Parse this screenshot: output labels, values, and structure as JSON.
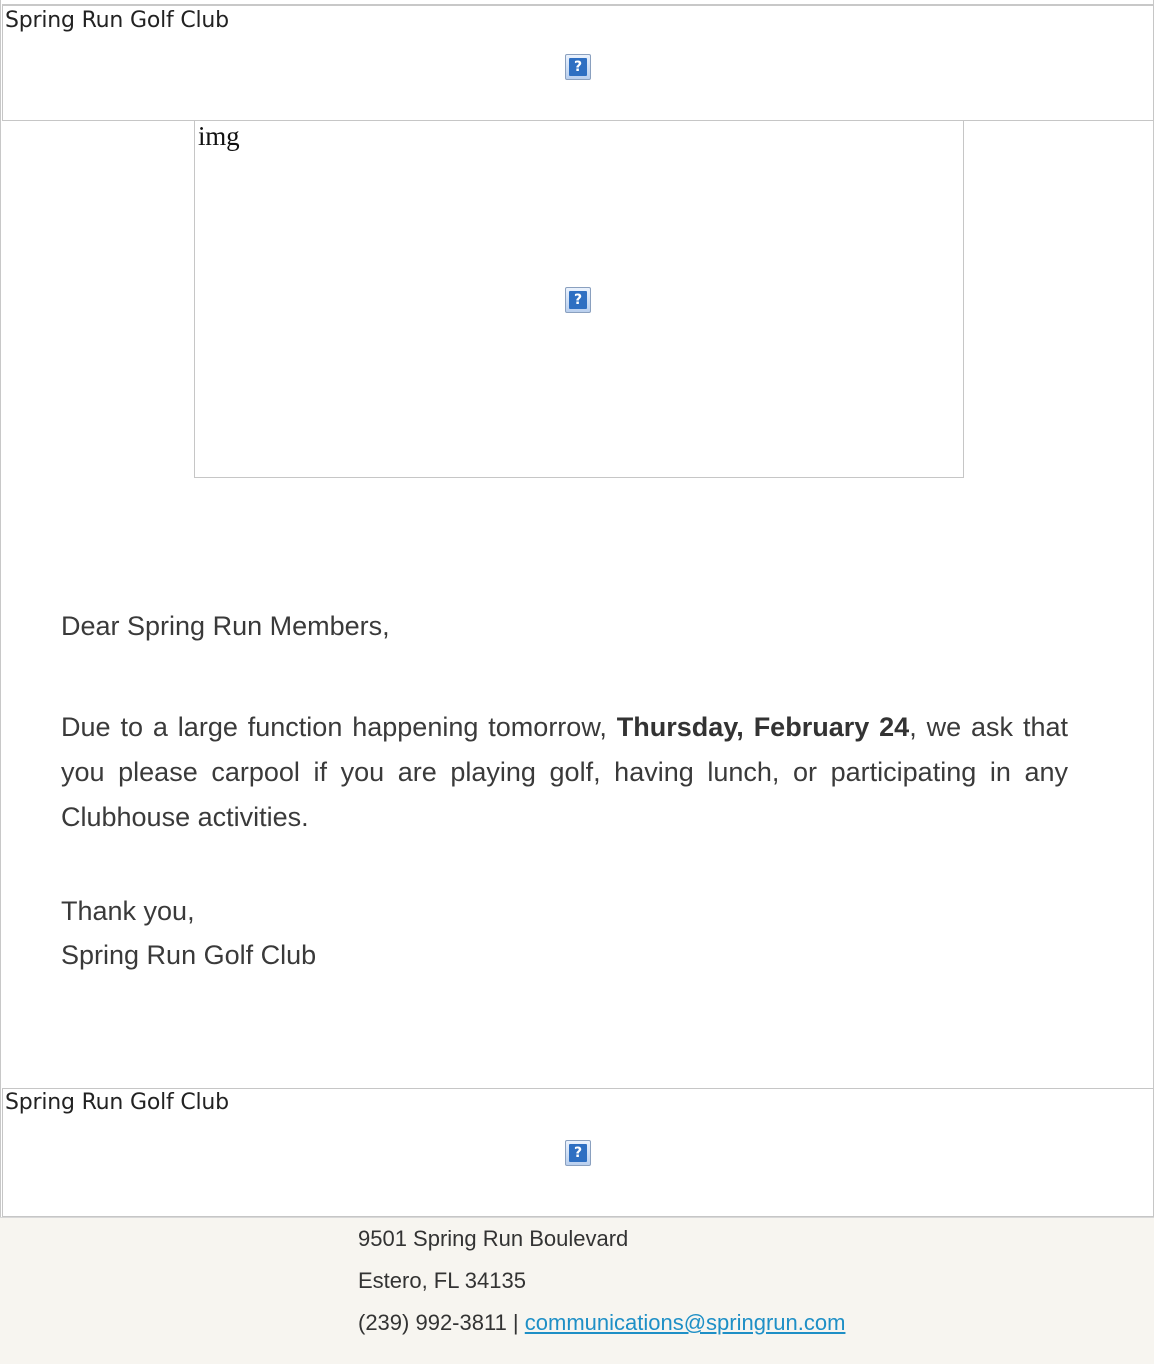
{
  "header": {
    "alt_text": "Spring Run Golf Club",
    "icon": "broken-image-icon"
  },
  "hero": {
    "alt_text": "img",
    "icon": "broken-image-icon"
  },
  "message": {
    "greeting": "Dear Spring Run Members,",
    "para_before": "Due to a large function happening tomorrow, ",
    "para_bold": "Thursday, February 24",
    "para_after": ", we ask that you please carpool if you are playing golf, having lunch, or participating in any Clubhouse activities.",
    "signoff": "Thank you,",
    "signature": "Spring Run Golf Club"
  },
  "footer": {
    "alt_text": "Spring Run Golf Club",
    "icon": "broken-image-icon",
    "address_line1": "9501 Spring Run Boulevard",
    "address_line2": "Estero, FL 34135",
    "phone": "(239) 992-3811",
    "separator": " | ",
    "email": "communications@springrun.com"
  },
  "colors": {
    "link": "#1e8fc6",
    "footer_bg": "#f7f5f0",
    "text": "#333333"
  }
}
